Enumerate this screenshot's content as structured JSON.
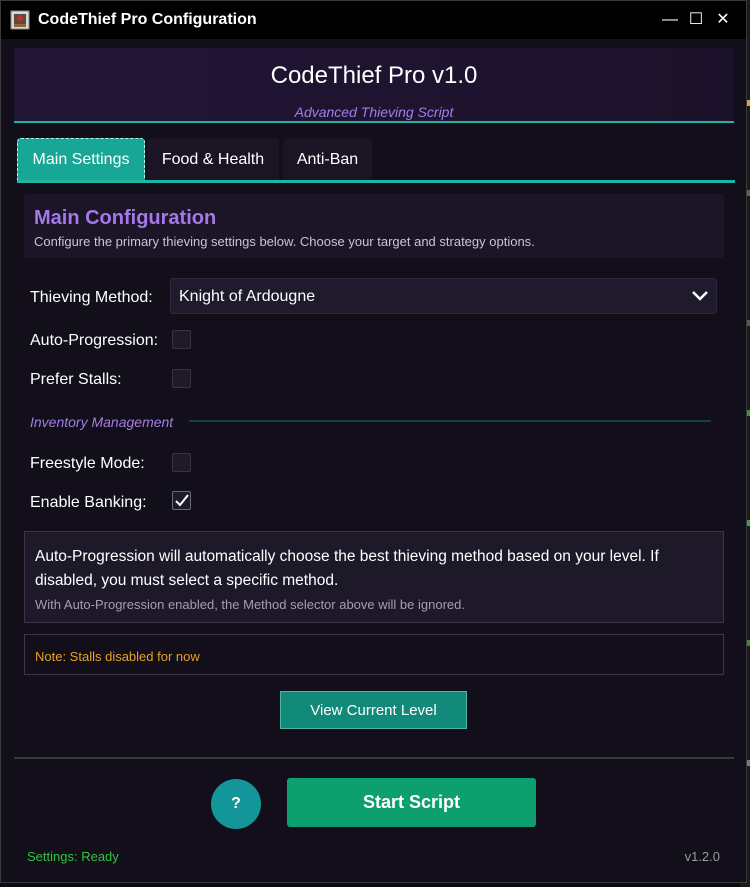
{
  "window": {
    "title": "CodeThief Pro Configuration",
    "controls": {
      "minimize": "—",
      "maximize": "☐",
      "close": "✕"
    }
  },
  "header": {
    "title": "CodeThief Pro v1.0",
    "subtitle": "Advanced Thieving Script"
  },
  "tabs": [
    {
      "label": "Main Settings",
      "active": true
    },
    {
      "label": "Food & Health",
      "active": false
    },
    {
      "label": "Anti-Ban",
      "active": false
    }
  ],
  "section": {
    "title": "Main Configuration",
    "description": "Configure the primary thieving settings below. Choose your target and strategy options."
  },
  "form": {
    "method_label": "Thieving Method:",
    "method_value": "Knight of Ardougne",
    "auto_progression_label": "Auto-Progression:",
    "auto_progression_checked": false,
    "prefer_stalls_label": "Prefer Stalls:",
    "prefer_stalls_checked": false,
    "inventory_heading": "Inventory Management",
    "freestyle_label": "Freestyle Mode:",
    "freestyle_checked": false,
    "banking_label": "Enable Banking:",
    "banking_checked": true
  },
  "info": {
    "main": "Auto-Progression will automatically choose the best thieving method based on your level. If disabled, you must select a specific method.",
    "sub": "With Auto-Progression enabled, the Method selector above will be ignored."
  },
  "note": "Note: Stalls disabled for now",
  "buttons": {
    "view_level": "View Current Level",
    "help": "?",
    "start": "Start Script"
  },
  "footer": {
    "status": "Settings: Ready",
    "version": "v1.2.0"
  },
  "colors": {
    "accent_teal": "#1fb5a5",
    "purple_heading": "#a578ea",
    "start_green": "#0e9f6f",
    "note_orange": "#e5a224",
    "status_green": "#33c43c"
  }
}
